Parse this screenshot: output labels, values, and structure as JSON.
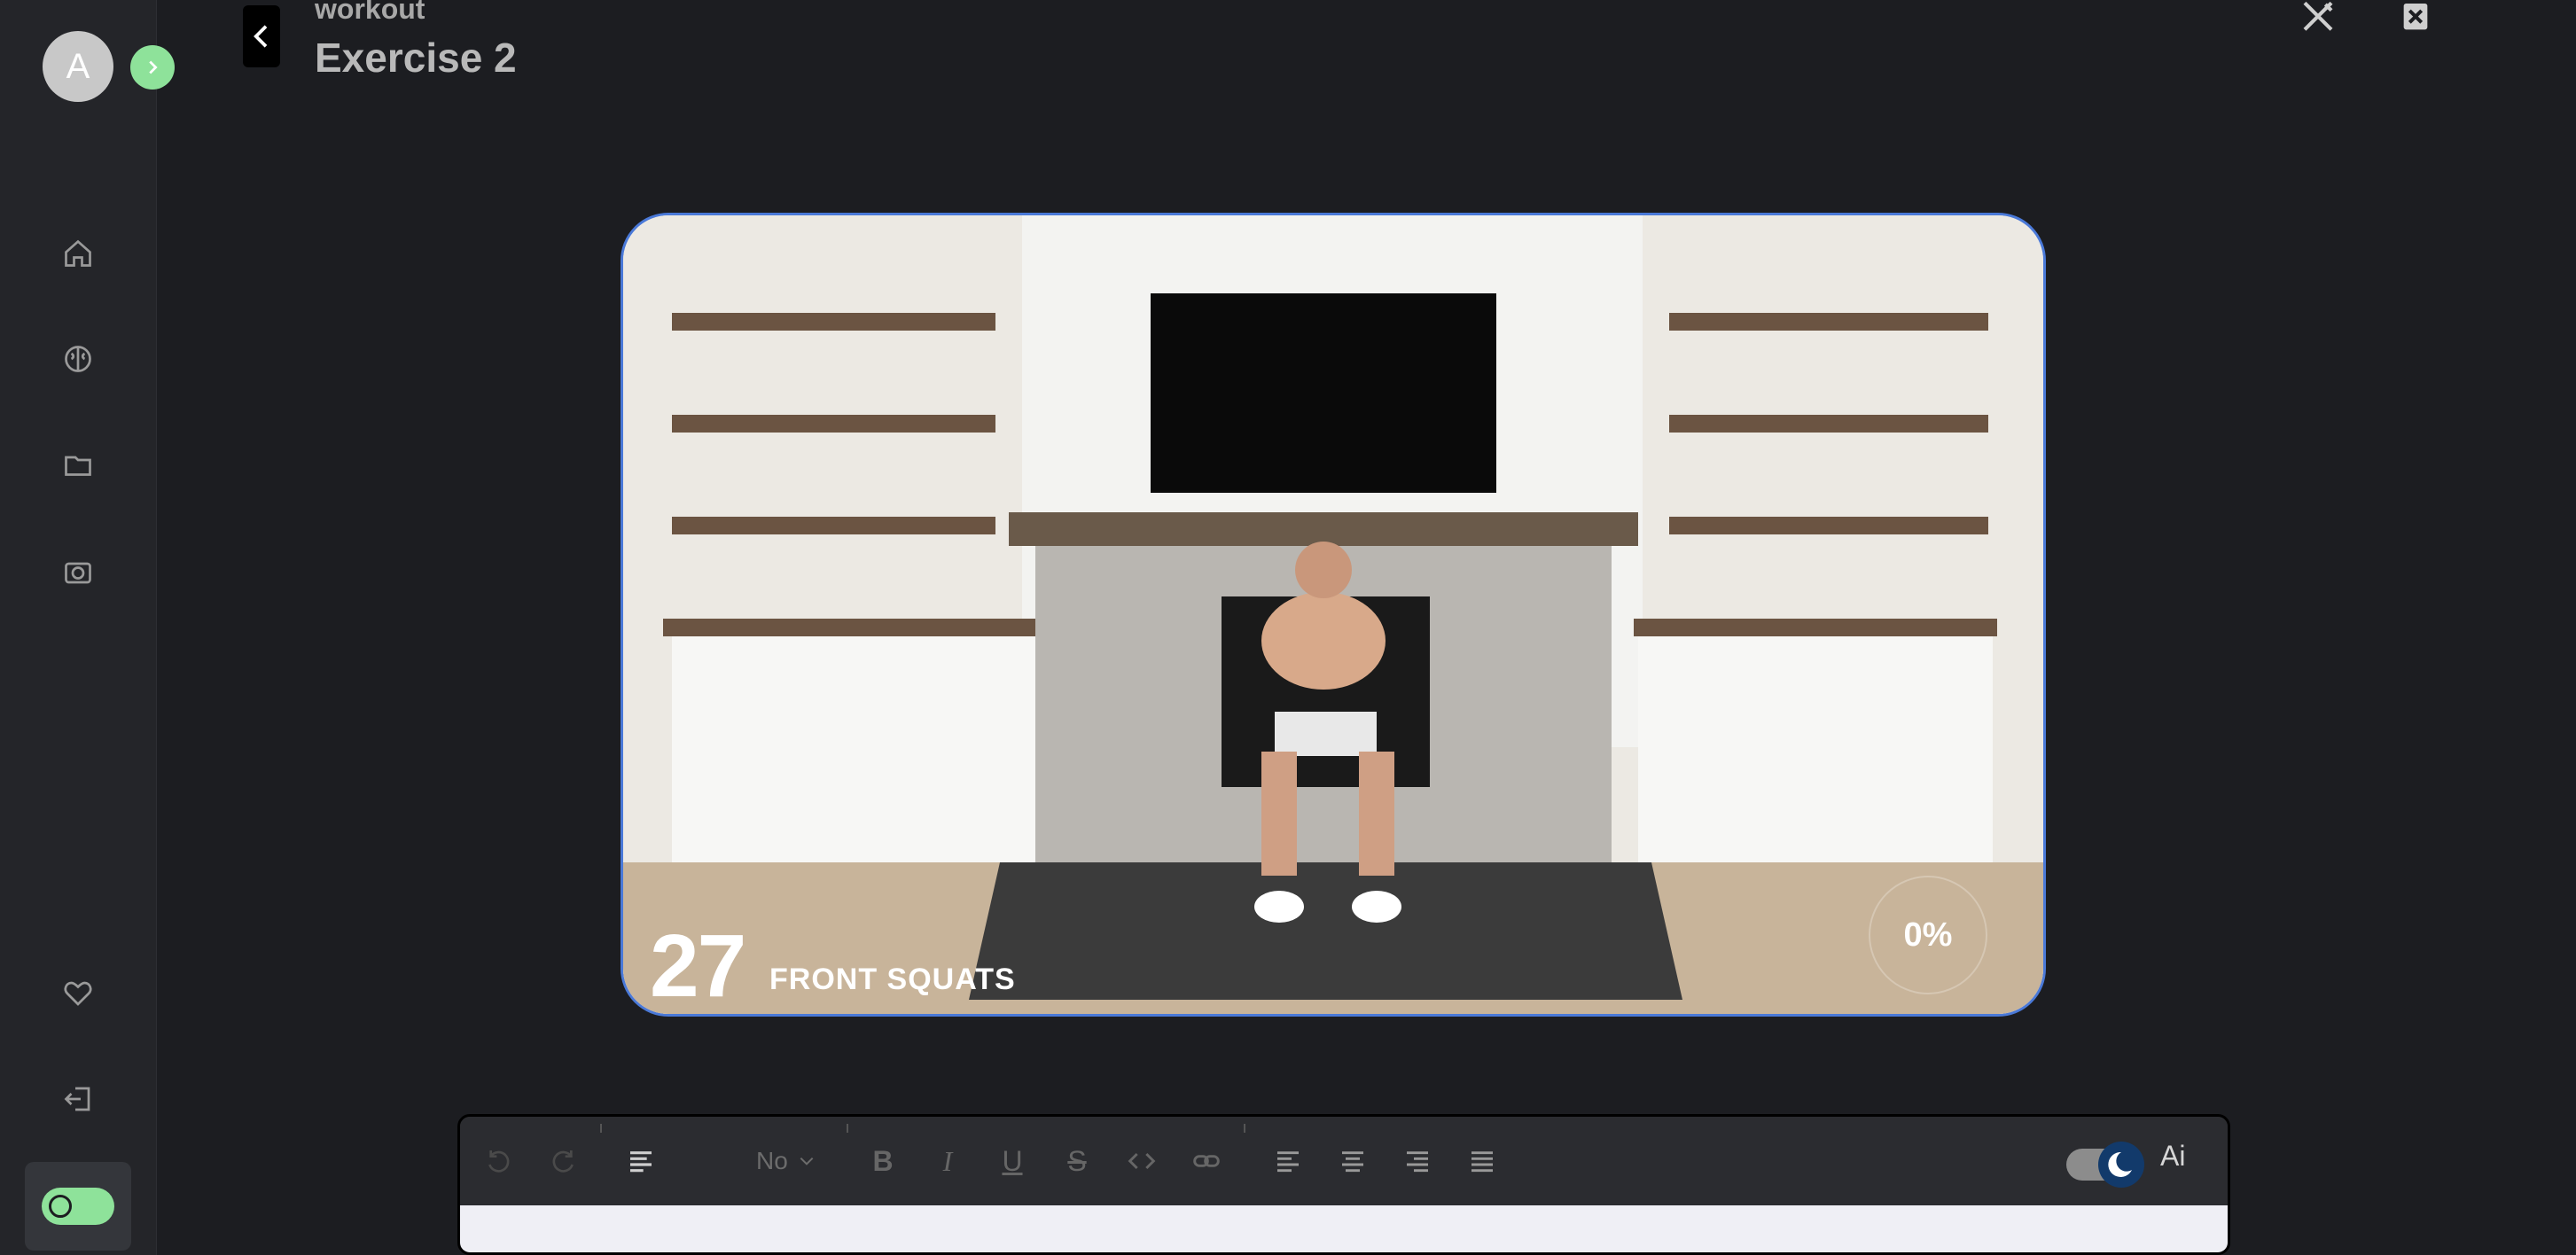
{
  "user": {
    "avatar_initial": "A"
  },
  "header": {
    "breadcrumb": "workout",
    "title": "Exercise 2"
  },
  "sidebar": {
    "items": [
      {
        "icon": "home-icon"
      },
      {
        "icon": "brain-icon"
      },
      {
        "icon": "folder-icon"
      },
      {
        "icon": "camera-icon"
      },
      {
        "icon": "heart-icon"
      },
      {
        "icon": "logout-icon"
      }
    ]
  },
  "video": {
    "rep_count": "27",
    "exercise_name": "FRONT SQUATS",
    "progress_text": "0%"
  },
  "editor": {
    "paragraph_style": "No",
    "ai_label": "Ai"
  },
  "colors": {
    "accent": "#8ee29a",
    "frame_border": "#4a79d8",
    "background": "#1c1d21"
  }
}
